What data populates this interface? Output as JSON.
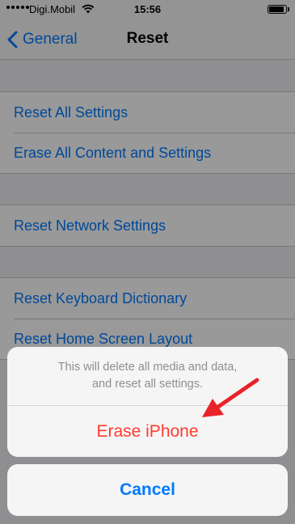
{
  "status_bar": {
    "carrier": "Digi.Mobil",
    "time": "15:56",
    "battery_level": 0.9
  },
  "nav": {
    "back_label": "General",
    "title": "Reset"
  },
  "groups": [
    {
      "items": [
        "Reset All Settings",
        "Erase All Content and Settings"
      ]
    },
    {
      "items": [
        "Reset Network Settings"
      ]
    },
    {
      "items": [
        "Reset Keyboard Dictionary",
        "Reset Home Screen Layout"
      ]
    }
  ],
  "action_sheet": {
    "message": "This will delete all media and data,\nand reset all settings.",
    "destructive_label": "Erase iPhone",
    "cancel_label": "Cancel"
  },
  "colors": {
    "link_blue": "#007aff",
    "destructive_red": "#ff3b30",
    "annotation_arrow": "#e8232a"
  },
  "icons": [
    "signal-dots-icon",
    "wifi-icon",
    "battery-icon",
    "chevron-left-icon",
    "annotation-arrow-icon"
  ]
}
